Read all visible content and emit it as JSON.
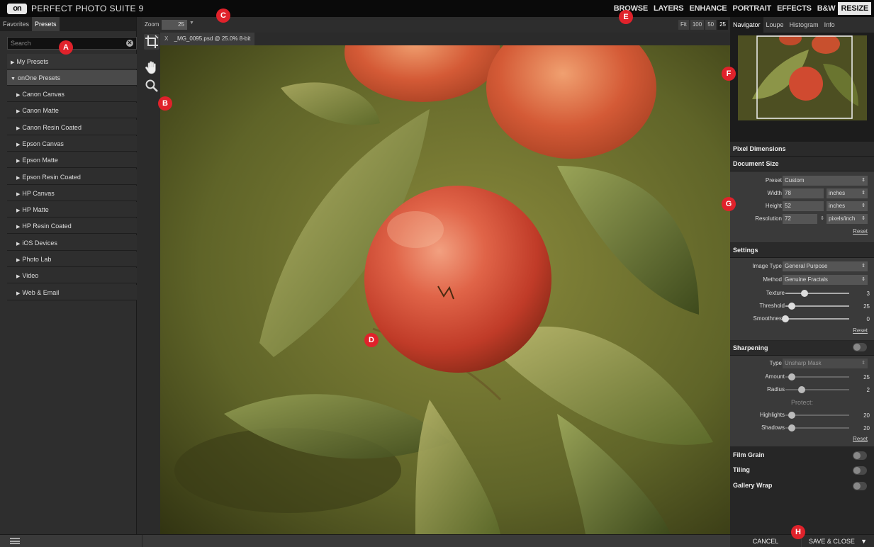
{
  "app": {
    "logo_text": "on",
    "title": "PERFECT PHOTO SUITE 9",
    "modules": [
      "BROWSE",
      "LAYERS",
      "ENHANCE",
      "PORTRAIT",
      "EFFECTS",
      "B&W",
      "RESIZE"
    ],
    "active_module": "RESIZE"
  },
  "left_panel": {
    "tabs": [
      "Favorites",
      "Presets"
    ],
    "active_tab": "Presets",
    "search_placeholder": "Search",
    "search_clear_glyph": "✕",
    "my_presets": "My Presets",
    "onone_presets": "onOne Presets",
    "presets": [
      "Canon Canvas",
      "Canon Matte",
      "Canon Resin Coated",
      "Epson Canvas",
      "Epson Matte",
      "Epson Resin Coated",
      "HP Canvas",
      "HP Matte",
      "HP Resin Coated",
      "iOS Devices",
      "Photo Lab",
      "Video",
      "Web & Email"
    ]
  },
  "zoom_bar": {
    "label": "Zoom",
    "value": "25",
    "presets": [
      "Fit",
      "100",
      "50",
      "25"
    ],
    "selected": "25"
  },
  "document": {
    "close_glyph": "X",
    "tab_title": "_MG_0095.psd @ 25.0% 8-bit"
  },
  "navigator": {
    "tabs": [
      "Navigator",
      "Loupe",
      "Histogram",
      "Info"
    ],
    "active_tab": "Navigator",
    "zoom_presets": [
      "Fit",
      "100",
      "50",
      "25"
    ]
  },
  "resize_panel": {
    "pixel_dimensions": "Pixel Dimensions",
    "document_size": "Document Size",
    "preset_label": "Preset",
    "preset_value": "Custom",
    "width_label": "Width",
    "width_value": "78",
    "width_unit": "inches",
    "height_label": "Height",
    "height_value": "52",
    "height_unit": "inches",
    "resolution_label": "Resolution",
    "resolution_value": "72",
    "resolution_unit": "pixels/inch",
    "reset": "Reset",
    "settings_title": "Settings",
    "image_type_label": "Image Type",
    "image_type_value": "General Purpose",
    "method_label": "Method",
    "method_value": "Genuine Fractals",
    "texture_label": "Texture",
    "texture_value": "3",
    "texture_level": 0.3,
    "threshold_label": "Threshold",
    "threshold_value": "25",
    "threshold_level": 0.1,
    "smoothness_label": "Smoothness",
    "smoothness_value": "0",
    "smoothness_level": 0.0,
    "sharpening_title": "Sharpening",
    "type_label": "Type",
    "type_value": "Unsharp Mask",
    "amount_label": "Amount",
    "amount_value": "25",
    "amount_level": 0.1,
    "radius_label": "Radius",
    "radius_value": "2",
    "radius_level": 0.25,
    "protect_label": "Protect:",
    "highlights_label": "Highlights",
    "highlights_value": "20",
    "highlights_level": 0.1,
    "shadows_label": "Shadows",
    "shadows_value": "20",
    "shadows_level": 0.1,
    "film_grain": "Film Grain",
    "tiling": "Tiling",
    "gallery_wrap": "Gallery Wrap"
  },
  "bottom_bar": {
    "cancel": "CANCEL",
    "save_close": "SAVE & CLOSE",
    "save_arrow": "▼"
  },
  "markers": [
    "A",
    "B",
    "C",
    "D",
    "E",
    "F",
    "G",
    "H"
  ],
  "colors": {
    "marker": "#e0222b",
    "apple_red": "#c8402c",
    "leaf_green": "#7a8a3a"
  }
}
